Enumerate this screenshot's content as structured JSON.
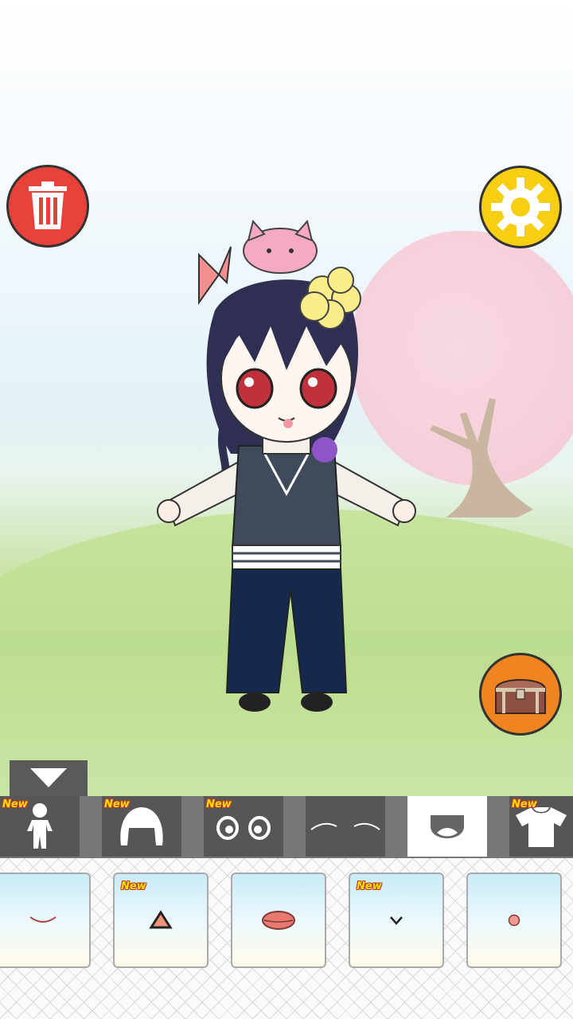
{
  "buttons": {
    "trash": {
      "icon": "trash-icon"
    },
    "settings": {
      "icon": "gear-icon"
    },
    "chest": {
      "icon": "treasure-chest-icon"
    },
    "collapse": {
      "icon": "triangle-down-icon"
    }
  },
  "categories": [
    {
      "name": "body",
      "icon": "body-icon",
      "badge": "New",
      "active": false
    },
    {
      "name": "hair",
      "icon": "hair-icon",
      "badge": "New",
      "active": false
    },
    {
      "name": "eyes",
      "icon": "eyes-icon",
      "badge": "New",
      "active": false
    },
    {
      "name": "eyebrows",
      "icon": "eyebrows-icon",
      "badge": "",
      "active": false
    },
    {
      "name": "mouth",
      "icon": "mouth-icon",
      "badge": "",
      "active": true
    },
    {
      "name": "clothes",
      "icon": "shirt-icon",
      "badge": "New",
      "active": false
    }
  ],
  "items": [
    {
      "name": "mouth-smile",
      "badge": ""
    },
    {
      "name": "mouth-triangle",
      "badge": "New"
    },
    {
      "name": "mouth-lips",
      "badge": ""
    },
    {
      "name": "mouth-small-v",
      "badge": "New"
    },
    {
      "name": "mouth-dot",
      "badge": ""
    }
  ],
  "colors": {
    "trash": "#e8413a",
    "settings": "#f7ce12",
    "chest": "#f08421",
    "active_tab": "#ffffff",
    "tab": "#565656"
  }
}
